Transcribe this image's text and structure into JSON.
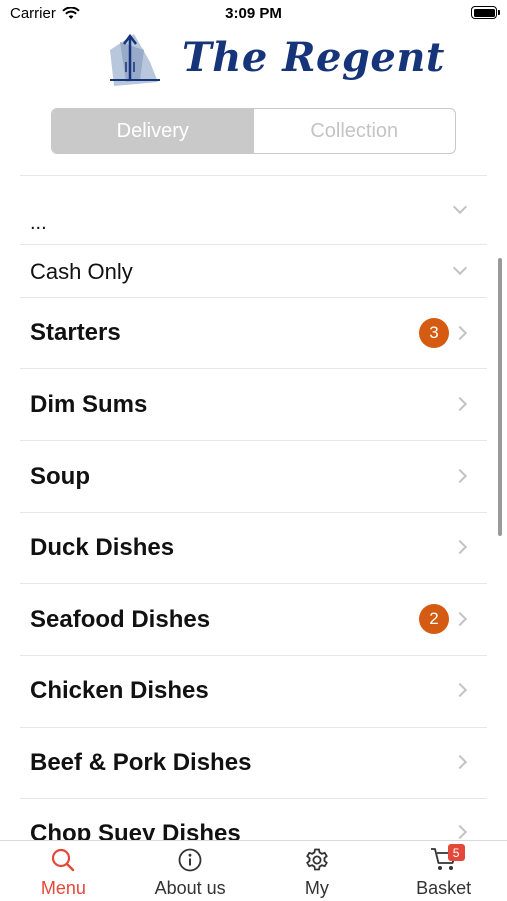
{
  "status_bar": {
    "carrier": "Carrier",
    "time": "3:09 PM"
  },
  "brand": {
    "name": "The Regent"
  },
  "order_mode": {
    "options": [
      "Delivery",
      "Collection"
    ],
    "selected": "Delivery"
  },
  "selectors": {
    "address": "...",
    "payment": "Cash Only"
  },
  "categories": [
    {
      "name": "Starters",
      "badge": "3"
    },
    {
      "name": "Dim Sums"
    },
    {
      "name": "Soup"
    },
    {
      "name": "Duck Dishes"
    },
    {
      "name": "Seafood Dishes",
      "badge": "2"
    },
    {
      "name": "Chicken Dishes"
    },
    {
      "name": "Beef & Pork Dishes"
    },
    {
      "name": "Chop Suey Dishes"
    }
  ],
  "tabbar": {
    "tabs": [
      {
        "label": "Menu",
        "icon": "search-icon",
        "active": true
      },
      {
        "label": "About us",
        "icon": "info-icon"
      },
      {
        "label": "My",
        "icon": "gear-icon"
      },
      {
        "label": "Basket",
        "icon": "cart-icon",
        "count": "5"
      }
    ],
    "active_color": "#e4483a"
  },
  "colors": {
    "badge": "#d55a12",
    "brand": "#16347a"
  }
}
